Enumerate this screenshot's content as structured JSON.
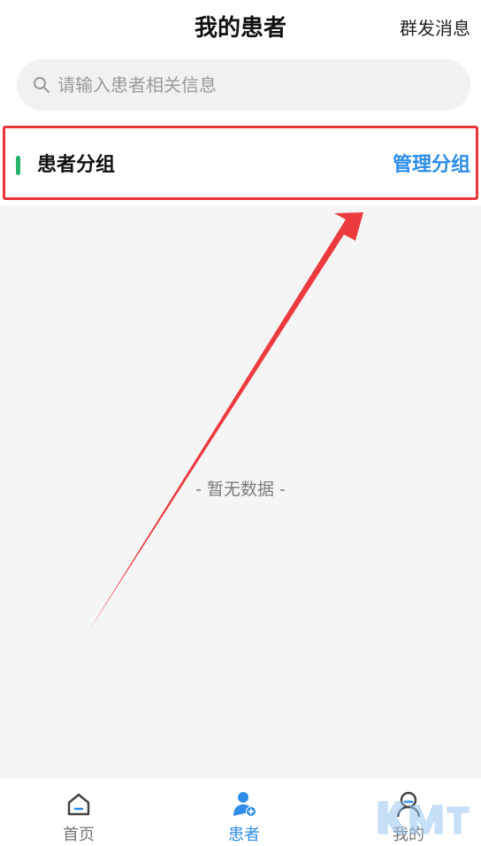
{
  "header": {
    "title": "我的患者",
    "bulk_message_label": "群发消息"
  },
  "search": {
    "placeholder": "请输入患者相关信息",
    "value": ""
  },
  "patient_groups": {
    "title": "患者分组",
    "manage_label": "管理分组",
    "accent_color": "#26b36a",
    "highlight_color": "#e8343a"
  },
  "empty_state": {
    "text": "- 暂无数据 -"
  },
  "tabbar": {
    "active_color": "#2d8de8",
    "tabs": [
      {
        "label": "首页",
        "icon": "home-icon",
        "active": false
      },
      {
        "label": "患者",
        "icon": "patient-icon",
        "active": true
      },
      {
        "label": "我的",
        "icon": "profile-icon",
        "active": false
      }
    ]
  }
}
